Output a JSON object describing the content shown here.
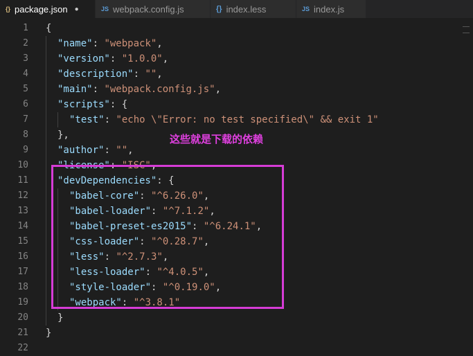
{
  "tabs": [
    {
      "icon": "{}",
      "label": "package.json",
      "dirty_marker": "●"
    },
    {
      "icon": "JS",
      "label": "webpack.config.js"
    },
    {
      "icon": "{}",
      "label": "index.less"
    },
    {
      "icon": "JS",
      "label": "index.js"
    }
  ],
  "annotation": "这些就是下载的依赖",
  "colors": {
    "highlight_box": "#d63cd6",
    "annotation": "#e040e0",
    "string": "#ce9178",
    "key": "#9cdcfe"
  },
  "code": {
    "line_numbers": [
      "1",
      "2",
      "3",
      "4",
      "5",
      "6",
      "7",
      "8",
      "9",
      "10",
      "11",
      "12",
      "13",
      "14",
      "15",
      "16",
      "17",
      "18",
      "19",
      "20",
      "21",
      "22"
    ],
    "lines": [
      {
        "indent": 0,
        "parts": [
          {
            "t": "p",
            "v": "{"
          }
        ]
      },
      {
        "indent": 1,
        "parts": [
          {
            "t": "k",
            "v": "\"name\""
          },
          {
            "t": "p",
            "v": ": "
          },
          {
            "t": "s",
            "v": "\"webpack\""
          },
          {
            "t": "p",
            "v": ","
          }
        ]
      },
      {
        "indent": 1,
        "parts": [
          {
            "t": "k",
            "v": "\"version\""
          },
          {
            "t": "p",
            "v": ": "
          },
          {
            "t": "s",
            "v": "\"1.0.0\""
          },
          {
            "t": "p",
            "v": ","
          }
        ]
      },
      {
        "indent": 1,
        "parts": [
          {
            "t": "k",
            "v": "\"description\""
          },
          {
            "t": "p",
            "v": ": "
          },
          {
            "t": "s",
            "v": "\"\""
          },
          {
            "t": "p",
            "v": ","
          }
        ]
      },
      {
        "indent": 1,
        "parts": [
          {
            "t": "k",
            "v": "\"main\""
          },
          {
            "t": "p",
            "v": ": "
          },
          {
            "t": "s",
            "v": "\"webpack.config.js\""
          },
          {
            "t": "p",
            "v": ","
          }
        ]
      },
      {
        "indent": 1,
        "parts": [
          {
            "t": "k",
            "v": "\"scripts\""
          },
          {
            "t": "p",
            "v": ": {"
          }
        ]
      },
      {
        "indent": 2,
        "parts": [
          {
            "t": "k",
            "v": "\"test\""
          },
          {
            "t": "p",
            "v": ": "
          },
          {
            "t": "s",
            "v": "\"echo \\\"Error: no test specified\\\" && exit 1\""
          }
        ]
      },
      {
        "indent": 1,
        "parts": [
          {
            "t": "p",
            "v": "},"
          }
        ]
      },
      {
        "indent": 1,
        "parts": [
          {
            "t": "k",
            "v": "\"author\""
          },
          {
            "t": "p",
            "v": ": "
          },
          {
            "t": "s",
            "v": "\"\""
          },
          {
            "t": "p",
            "v": ","
          }
        ]
      },
      {
        "indent": 1,
        "parts": [
          {
            "t": "k",
            "v": "\"license\""
          },
          {
            "t": "p",
            "v": ": "
          },
          {
            "t": "s",
            "v": "\"ISC\""
          },
          {
            "t": "p",
            "v": ","
          }
        ]
      },
      {
        "indent": 1,
        "parts": [
          {
            "t": "k",
            "v": "\"devDependencies\""
          },
          {
            "t": "p",
            "v": ": {"
          }
        ]
      },
      {
        "indent": 2,
        "parts": [
          {
            "t": "k",
            "v": "\"babel-core\""
          },
          {
            "t": "p",
            "v": ": "
          },
          {
            "t": "s",
            "v": "\"^6.26.0\""
          },
          {
            "t": "p",
            "v": ","
          }
        ]
      },
      {
        "indent": 2,
        "parts": [
          {
            "t": "k",
            "v": "\"babel-loader\""
          },
          {
            "t": "p",
            "v": ": "
          },
          {
            "t": "s",
            "v": "\"^7.1.2\""
          },
          {
            "t": "p",
            "v": ","
          }
        ]
      },
      {
        "indent": 2,
        "parts": [
          {
            "t": "k",
            "v": "\"babel-preset-es2015\""
          },
          {
            "t": "p",
            "v": ": "
          },
          {
            "t": "s",
            "v": "\"^6.24.1\""
          },
          {
            "t": "p",
            "v": ","
          }
        ]
      },
      {
        "indent": 2,
        "parts": [
          {
            "t": "k",
            "v": "\"css-loader\""
          },
          {
            "t": "p",
            "v": ": "
          },
          {
            "t": "s",
            "v": "\"^0.28.7\""
          },
          {
            "t": "p",
            "v": ","
          }
        ]
      },
      {
        "indent": 2,
        "parts": [
          {
            "t": "k",
            "v": "\"less\""
          },
          {
            "t": "p",
            "v": ": "
          },
          {
            "t": "s",
            "v": "\"^2.7.3\""
          },
          {
            "t": "p",
            "v": ","
          }
        ]
      },
      {
        "indent": 2,
        "parts": [
          {
            "t": "k",
            "v": "\"less-loader\""
          },
          {
            "t": "p",
            "v": ": "
          },
          {
            "t": "s",
            "v": "\"^4.0.5\""
          },
          {
            "t": "p",
            "v": ","
          }
        ]
      },
      {
        "indent": 2,
        "parts": [
          {
            "t": "k",
            "v": "\"style-loader\""
          },
          {
            "t": "p",
            "v": ": "
          },
          {
            "t": "s",
            "v": "\"^0.19.0\""
          },
          {
            "t": "p",
            "v": ","
          }
        ]
      },
      {
        "indent": 2,
        "parts": [
          {
            "t": "k",
            "v": "\"webpack\""
          },
          {
            "t": "p",
            "v": ": "
          },
          {
            "t": "s",
            "v": "\"^3.8.1\""
          }
        ]
      },
      {
        "indent": 1,
        "parts": [
          {
            "t": "p",
            "v": "}"
          }
        ]
      },
      {
        "indent": 0,
        "parts": [
          {
            "t": "p",
            "v": "}"
          }
        ]
      },
      {
        "indent": 0,
        "parts": []
      }
    ]
  }
}
